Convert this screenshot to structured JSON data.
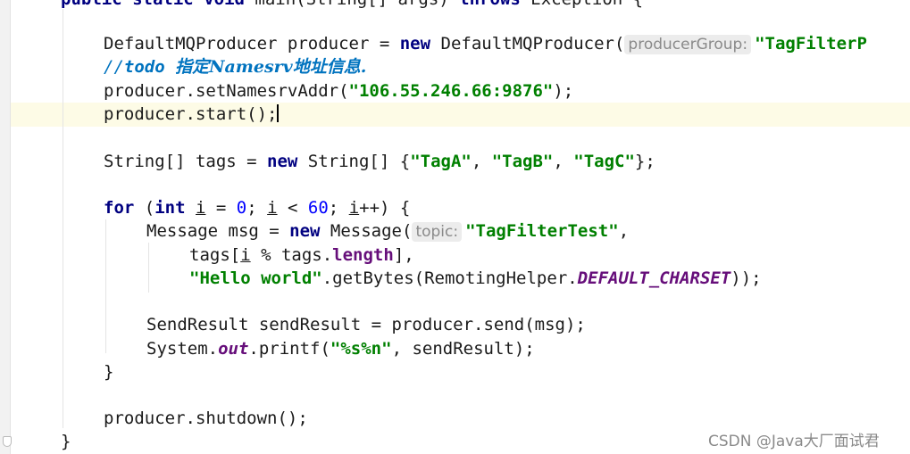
{
  "editor": {
    "line_partial_top": {
      "kw1": "public",
      "kw2": "static",
      "kw3": "void",
      "rest": "main(String[] args)",
      "kw4": "throws",
      "tail": "Exception {"
    },
    "line_producer": {
      "decl": "DefaultMQProducer producer = ",
      "kw_new": "new",
      "ctor": " DefaultMQProducer(",
      "hint": "producerGroup:",
      "arg": "\"TagFilterP"
    },
    "line_comment": {
      "slashes": "//",
      "todo": "todo",
      "text": "指定Namesrv地址信息."
    },
    "line_namesrv": {
      "call": "producer.setNamesrvAddr(",
      "arg": "\"106.55.246.66:9876\"",
      "end": ");"
    },
    "line_start": {
      "text": "producer.start();"
    },
    "line_tags": {
      "decl": "String[] tags = ",
      "kw_new": "new",
      "type": " String[] {",
      "tag_a": "\"TagA\"",
      "sep1": ", ",
      "tag_b": "\"TagB\"",
      "sep2": ", ",
      "tag_c": "\"TagC\"",
      "end": "};"
    },
    "line_for": {
      "kw_for": "for",
      "open": " (",
      "kw_int": "int",
      "sp": " ",
      "var1": "i",
      "eq": " = ",
      "zero": "0",
      "semi1": "; ",
      "var2": "i",
      "lt": " < ",
      "sixty": "60",
      "semi2": "; ",
      "var3": "i",
      "incr": "++) {"
    },
    "line_message": {
      "decl": "Message msg = ",
      "kw_new": "new",
      "ctor": " Message(",
      "hint": "topic:",
      "arg": "\"TagFilterTest\"",
      "end": ","
    },
    "line_tags_index": {
      "pre": "tags[",
      "var": "i",
      "mid": " % tags.",
      "field": "length",
      "end": "],"
    },
    "line_hello": {
      "str": "\"Hello world\"",
      "call": ".getBytes(RemotingHelper.",
      "const": "DEFAULT_CHARSET",
      "end": "));"
    },
    "line_send": {
      "text": "SendResult sendResult = producer.send(msg);"
    },
    "line_printf": {
      "pre": "System.",
      "field": "out",
      "call": ".printf(",
      "fmt": "\"%s%n\"",
      "end": ", sendResult);"
    },
    "line_close_for": {
      "text": "}"
    },
    "line_shutdown": {
      "text": "producer.shutdown();"
    },
    "line_close_main": {
      "text": "}"
    }
  },
  "watermark": {
    "text": "CSDN @Java大厂面试君"
  },
  "colors": {
    "keyword": "#000080",
    "string": "#008000",
    "number": "#0000ff",
    "comment": "#0073bf",
    "field": "#660e7a",
    "caret_line": "#fdfbe6"
  }
}
